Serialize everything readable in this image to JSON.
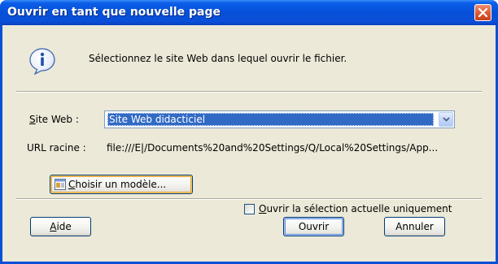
{
  "window": {
    "title": "Ouvrir en tant que nouvelle page"
  },
  "dialog": {
    "prompt": "Sélectionnez le site Web dans lequel ouvrir le fichier.",
    "site_label_accel": "S",
    "site_label_rest": "ite Web :",
    "site_value": "Site Web didacticiel",
    "url_label": "URL racine :",
    "url_value": "file:///E|/Documents%20and%20Settings/Q/Local%20Settings/App...",
    "choose_template_accel": "C",
    "choose_template_rest": "hoisir un modèle...",
    "checkbox_accel": "O",
    "checkbox_rest": "uvrir la sélection actuelle uniquement",
    "checkbox_checked": false
  },
  "buttons": {
    "help_accel": "A",
    "help_rest": "ide",
    "open": "Ouvrir",
    "cancel": "Annuler"
  },
  "colors": {
    "title_bar": "#0a4fd8",
    "client_bg": "#ece9d8",
    "selection": "#316ac5"
  },
  "icons": [
    "info-icon",
    "close-icon",
    "dropdown-arrow-icon",
    "template-icon"
  ]
}
